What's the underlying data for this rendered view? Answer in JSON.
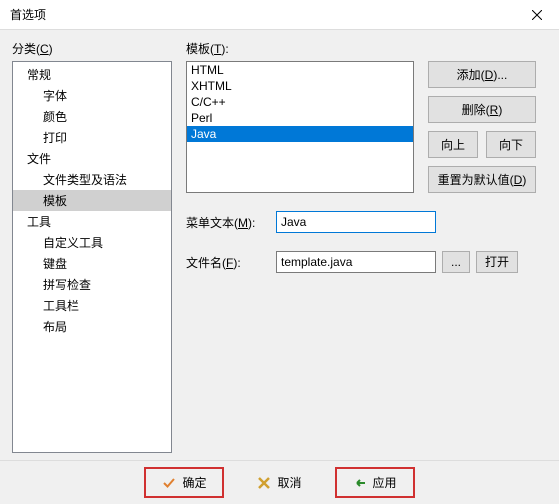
{
  "window": {
    "title": "首选项"
  },
  "category": {
    "label_pre": "分类(",
    "label_key": "C",
    "label_post": ")",
    "items": [
      {
        "label": "常规",
        "level": 0
      },
      {
        "label": "字体",
        "level": 1
      },
      {
        "label": "颜色",
        "level": 1
      },
      {
        "label": "打印",
        "level": 1
      },
      {
        "label": "文件",
        "level": 0
      },
      {
        "label": "文件类型及语法",
        "level": 1
      },
      {
        "label": "模板",
        "level": 1,
        "selected": true
      },
      {
        "label": "工具",
        "level": 0
      },
      {
        "label": "自定义工具",
        "level": 1
      },
      {
        "label": "键盘",
        "level": 1
      },
      {
        "label": "拼写检查",
        "level": 1
      },
      {
        "label": "工具栏",
        "level": 1
      },
      {
        "label": "布局",
        "level": 1
      }
    ]
  },
  "templates": {
    "label_pre": "模板(",
    "label_key": "T",
    "label_post": "):",
    "items": [
      {
        "label": "HTML"
      },
      {
        "label": "XHTML"
      },
      {
        "label": "C/C++"
      },
      {
        "label": "Perl"
      },
      {
        "label": "Java",
        "selected": true
      }
    ]
  },
  "buttons": {
    "add_pre": "添加(",
    "add_key": "D",
    "add_post": ")...",
    "delete_pre": "删除(",
    "delete_key": "R",
    "delete_post": ")",
    "up": "向上",
    "down": "向下",
    "reset_pre": "重置为默认值(",
    "reset_key": "D",
    "reset_post": ")"
  },
  "menutext": {
    "label_pre": "菜单文本(",
    "label_key": "M",
    "label_post": "):",
    "value": "Java"
  },
  "filename": {
    "label_pre": "文件名(",
    "label_key": "F",
    "label_post": "):",
    "value": "template.java",
    "browse": "...",
    "open": "打开"
  },
  "footer": {
    "ok": "确定",
    "cancel": "取消",
    "apply": "应用"
  }
}
